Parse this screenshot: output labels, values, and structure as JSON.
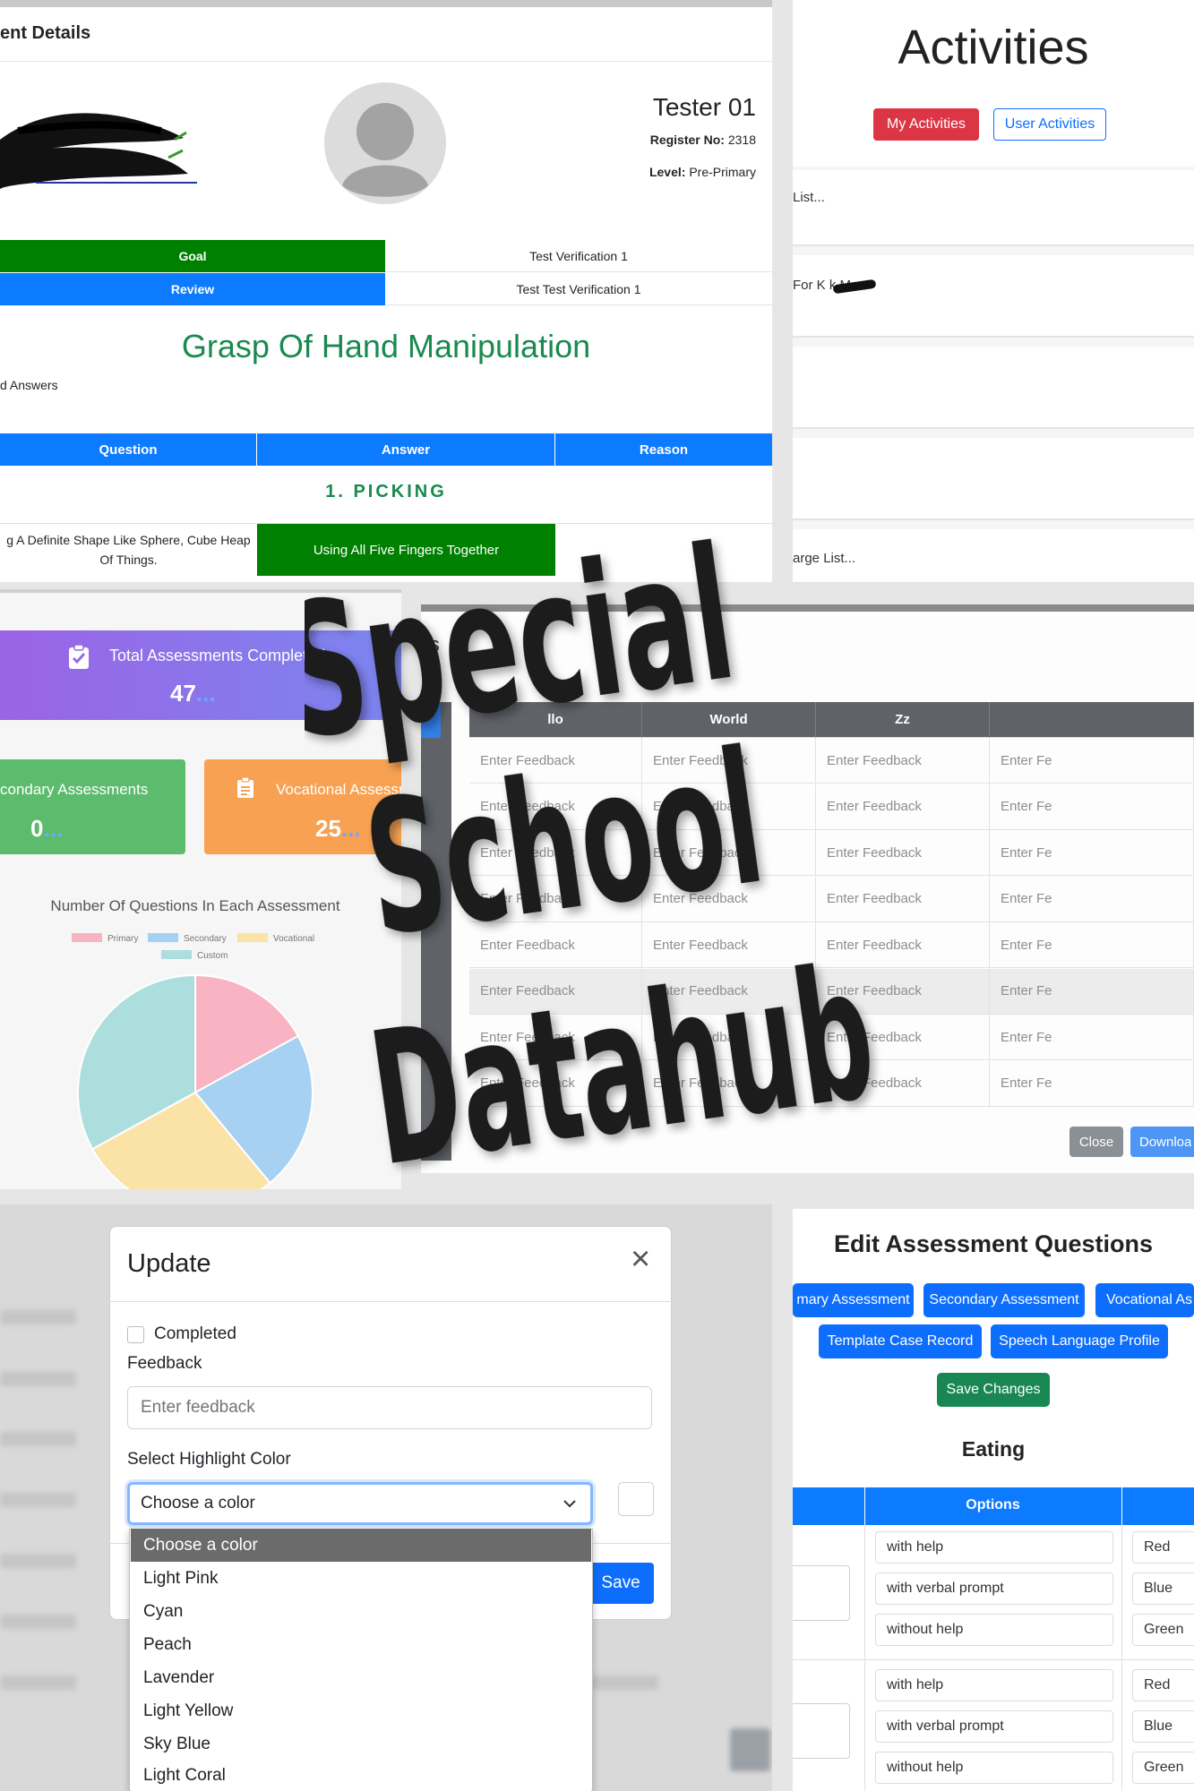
{
  "student_panel": {
    "header": "ent Details",
    "name": "Tester 01",
    "register_label": "Register No:",
    "register_value": "2318",
    "level_label": "Level:",
    "level_value": "Pre-Primary",
    "rows": [
      {
        "label": "Goal",
        "value": "Test Verification 1",
        "color": "#008000"
      },
      {
        "label": "Review",
        "value": "Test Test Verification 1",
        "color": "#0d7bff"
      }
    ],
    "heading": "Grasp Of Hand Manipulation",
    "answers_label": "d Answers",
    "table_headers": [
      "Question",
      "Answer",
      "Reason"
    ],
    "section_title": "1. PICKING",
    "question_text": "g A Definite Shape Like Sphere, Cube Heap Of Things.",
    "answer_text": "Using All Five Fingers Together"
  },
  "activities_panel": {
    "title": "Activities",
    "my_activities": "My Activities",
    "user_activities": "User Activities",
    "items": [
      "List...",
      "For K      k M...",
      "",
      "",
      "arge List..."
    ]
  },
  "dashboard_panel": {
    "total_label": "Total Assessments Completed",
    "total_value": "47",
    "secondary_label": "condary Assessments",
    "secondary_value": "0",
    "vocational_label": "Vocational Assessments",
    "vocational_value": "25",
    "loading_dots": "...",
    "chart_title": "Number Of Questions In Each Assessment"
  },
  "chart_data": {
    "type": "pie",
    "title": "Number Of Questions In Each Assessment",
    "categories": [
      "Primary",
      "Secondary",
      "Vocational",
      "Custom"
    ],
    "values": [
      17,
      22,
      28,
      33
    ],
    "colors": [
      "#f9b4c3",
      "#a6d1f2",
      "#fbe3a8",
      "#addede"
    ],
    "legend": "top"
  },
  "feedback_panel": {
    "title_fragment": "ils",
    "columns": [
      "llo",
      "World",
      "Zz",
      ""
    ],
    "placeholder": "Enter Feedback",
    "placeholder_short": "Enter Fe",
    "close_label": "Close",
    "download_label": "Downloa"
  },
  "update_modal": {
    "title": "Update",
    "close_icon": "×",
    "completed_label": "Completed",
    "feedback_label": "Feedback",
    "feedback_placeholder": "Enter feedback",
    "highlight_label": "Select Highlight Color",
    "select_value": "Choose a color",
    "save_label": "Save",
    "background_label": "Feedback",
    "options": [
      "Choose a color",
      "Light Pink",
      "Cyan",
      "Peach",
      "Lavender",
      "Light Yellow",
      "Sky Blue",
      "Light Coral"
    ]
  },
  "edit_panel": {
    "title": "Edit Assessment Questions",
    "buttons": [
      "mary Assessment",
      "Secondary Assessment",
      "Vocational As",
      "Template Case Record",
      "Speech Language Profile"
    ],
    "save_changes": "Save Changes",
    "section": "Eating",
    "options_header": "Options",
    "options": [
      "with help",
      "with verbal prompt",
      "without help",
      "with help",
      "with verbal prompt",
      "without help"
    ],
    "colors": [
      "Red",
      "Blue",
      "Green",
      "Red",
      "Blue",
      "Green"
    ]
  },
  "overlay": {
    "line1": "Special",
    "line2": "School",
    "line3": "Datahub"
  }
}
